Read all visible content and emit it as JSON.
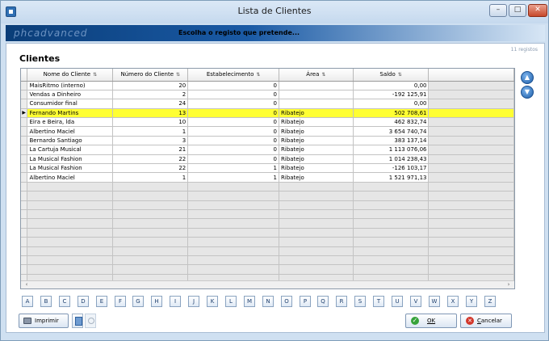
{
  "window": {
    "title": "Lista de Clientes"
  },
  "banner": {
    "logo": "phcadvanced",
    "message": "Escolha o registo que pretende..."
  },
  "section": {
    "title": "Clientes",
    "records": "11 registos"
  },
  "grid": {
    "columns": [
      {
        "label": "Nome do Cliente",
        "sort_icon": "sort-icon"
      },
      {
        "label": "Número do Cliente",
        "sort_icon": "sort-icon"
      },
      {
        "label": "Estabelecimento",
        "sort_icon": "sort-icon"
      },
      {
        "label": "Área",
        "sort_icon": "sort-icon"
      },
      {
        "label": "Saldo",
        "sort_icon": "sort-icon"
      }
    ],
    "rows": [
      [
        "MaisRitmo (interno)",
        "20",
        "0",
        "",
        "0,00"
      ],
      [
        "Vendas a Dinheiro",
        "2",
        "0",
        "",
        "-192 125,91"
      ],
      [
        "Consumidor final",
        "24",
        "0",
        "",
        "0,00"
      ],
      [
        "Fernando Martins",
        "13",
        "0",
        "Ribatejo",
        "502 708,61"
      ],
      [
        "Eira e Beira, lda",
        "10",
        "0",
        "Ribatejo",
        "462 832,74"
      ],
      [
        "Albertino Maciel",
        "1",
        "0",
        "Ribatejo",
        "3 654 740,74"
      ],
      [
        "Bernardo Santiago",
        "3",
        "0",
        "Ribatejo",
        "383 137,14"
      ],
      [
        "La Cartuja Musical",
        "21",
        "0",
        "Ribatejo",
        "1 113 076,06"
      ],
      [
        "La Musical Fashion",
        "22",
        "0",
        "Ribatejo",
        "1 014 238,43"
      ],
      [
        "La Musical Fashion",
        "22",
        "1",
        "Ribatejo",
        "-126 103,17"
      ],
      [
        "Albertino Maciel",
        "1",
        "1",
        "Ribatejo",
        "1 521 971,13"
      ]
    ],
    "selected_row": 3,
    "highlight_color": "#ffff33"
  },
  "alphabet": [
    "A",
    "B",
    "C",
    "D",
    "E",
    "F",
    "G",
    "H",
    "I",
    "J",
    "K",
    "L",
    "M",
    "N",
    "O",
    "P",
    "Q",
    "R",
    "S",
    "T",
    "U",
    "V",
    "W",
    "X",
    "Y",
    "Z"
  ],
  "buttons": {
    "print": "Imprimir",
    "ok": "OK",
    "cancel": "Cancelar"
  },
  "icons": {
    "app": "app-icon",
    "minimize": "minimize-icon",
    "maximize": "maximize-icon",
    "close": "close-icon",
    "scroll_up": "arrow-up-icon",
    "scroll_down": "arrow-down-icon",
    "print": "printer-icon",
    "ok": "check-icon",
    "cancel": "cancel-icon"
  }
}
